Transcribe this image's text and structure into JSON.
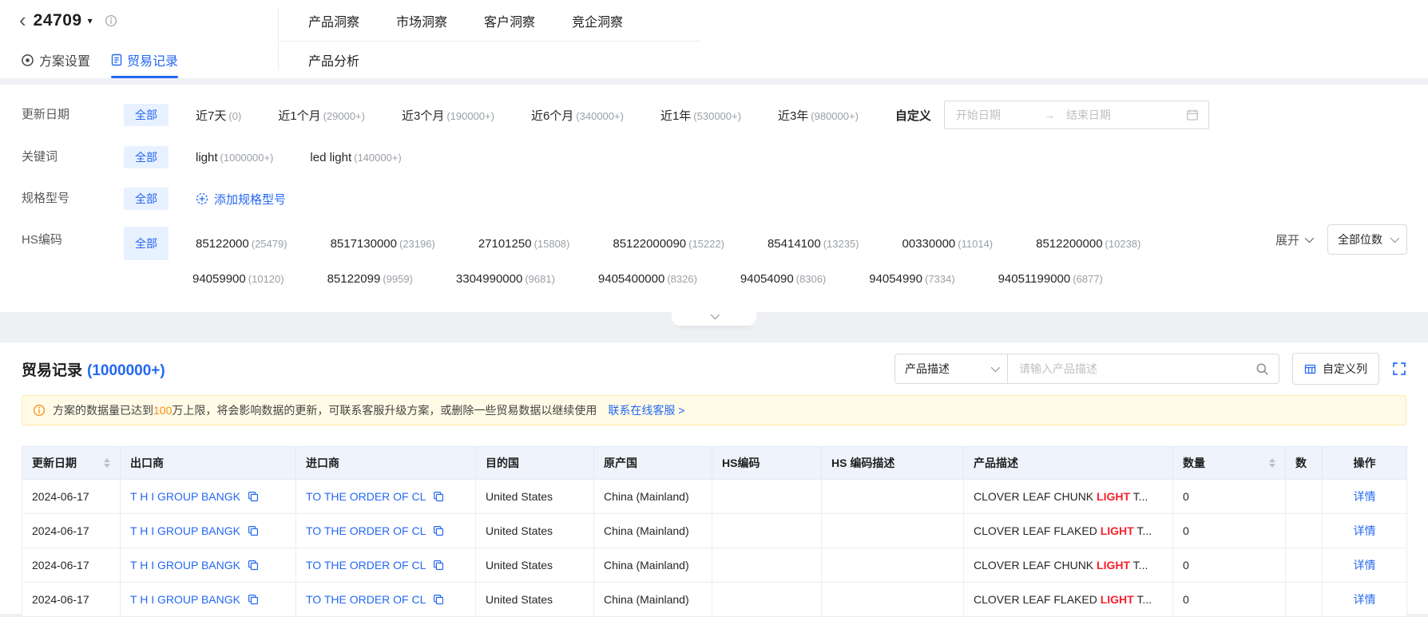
{
  "colors": {
    "accent": "#2468f2",
    "chip_bg": "#e8f1ff",
    "highlight_red": "#f5222d",
    "warn_orange": "#fa8c16",
    "warn_bg": "#fffbe6"
  },
  "icons": {
    "back": "‹",
    "caret_down": "▾"
  },
  "header": {
    "plan_id": "24709",
    "tabs": [
      "产品洞察",
      "市场洞察",
      "客户洞察",
      "竞企洞察"
    ],
    "sub_tabs": {
      "settings": "方案设置",
      "trade_records": "贸易记录",
      "product_analysis": "产品分析"
    }
  },
  "filters": {
    "update_date": {
      "label": "更新日期",
      "all_label": "全部",
      "options": [
        {
          "label": "近7天",
          "count": "(0)"
        },
        {
          "label": "近1个月",
          "count": "(29000+)"
        },
        {
          "label": "近3个月",
          "count": "(190000+)"
        },
        {
          "label": "近6个月",
          "count": "(340000+)"
        },
        {
          "label": "近1年",
          "count": "(530000+)"
        },
        {
          "label": "近3年",
          "count": "(980000+)"
        }
      ],
      "custom_label": "自定义",
      "start_placeholder": "开始日期",
      "end_placeholder": "结束日期",
      "range_arrow": "→"
    },
    "keyword": {
      "label": "关键词",
      "all_label": "全部",
      "options": [
        {
          "label": "light",
          "count": "(1000000+)"
        },
        {
          "label": "led light",
          "count": "(140000+)"
        }
      ]
    },
    "spec": {
      "label": "规格型号",
      "all_label": "全部",
      "add_label": "添加规格型号"
    },
    "hs_code": {
      "label": "HS编码",
      "all_label": "全部",
      "row1": [
        {
          "code": "85122000",
          "count": "(25479)"
        },
        {
          "code": "8517130000",
          "count": "(23196)"
        },
        {
          "code": "27101250",
          "count": "(15808)"
        },
        {
          "code": "85122000090",
          "count": "(15222)"
        },
        {
          "code": "85414100",
          "count": "(13235)"
        },
        {
          "code": "00330000",
          "count": "(11014)"
        },
        {
          "code": "8512200000",
          "count": "(10238)"
        }
      ],
      "row2": [
        {
          "code": "94059900",
          "count": "(10120)"
        },
        {
          "code": "85122099",
          "count": "(9959)"
        },
        {
          "code": "3304990000",
          "count": "(9681)"
        },
        {
          "code": "9405400000",
          "count": "(8326)"
        },
        {
          "code": "94054090",
          "count": "(8306)"
        },
        {
          "code": "94054990",
          "count": "(7334)"
        },
        {
          "code": "94051199000",
          "count": "(6877)"
        }
      ],
      "expand_label": "展开",
      "digits_label": "全部位数"
    }
  },
  "records": {
    "title": "贸易记录",
    "count": "(1000000+)",
    "search": {
      "type_label": "产品描述",
      "placeholder": "请输入产品描述"
    },
    "custom_columns_label": "自定义列",
    "banner": {
      "text_before": "方案的数据量已达到",
      "highlight": "100",
      "text_after": "万上限，将会影响数据的更新，可联系客服升级方案，或删除一些贸易数据以继续使用",
      "link_label": "联系在线客服 >"
    },
    "table": {
      "columns": [
        "更新日期",
        "出口商",
        "进口商",
        "目的国",
        "原产国",
        "HS编码",
        "HS 编码描述",
        "产品描述",
        "数量",
        "数",
        "操作"
      ],
      "rows": [
        {
          "date": "2024-06-17",
          "exporter": "T H I GROUP BANGK",
          "importer": "TO THE ORDER OF CL",
          "destination": "United States",
          "origin": "China (Mainland)",
          "hs_code": "",
          "hs_desc": "",
          "product": {
            "pre": "CLOVER LEAF CHUNK ",
            "highlight": "LIGHT",
            "post": " T..."
          },
          "quantity": "0",
          "extra": "",
          "action": "详情"
        },
        {
          "date": "2024-06-17",
          "exporter": "T H I GROUP BANGK",
          "importer": "TO THE ORDER OF CL",
          "destination": "United States",
          "origin": "China (Mainland)",
          "hs_code": "",
          "hs_desc": "",
          "product": {
            "pre": "CLOVER LEAF FLAKED ",
            "highlight": "LIGHT",
            "post": " T..."
          },
          "quantity": "0",
          "extra": "",
          "action": "详情"
        },
        {
          "date": "2024-06-17",
          "exporter": "T H I GROUP BANGK",
          "importer": "TO THE ORDER OF CL",
          "destination": "United States",
          "origin": "China (Mainland)",
          "hs_code": "",
          "hs_desc": "",
          "product": {
            "pre": "CLOVER LEAF CHUNK ",
            "highlight": "LIGHT",
            "post": " T..."
          },
          "quantity": "0",
          "extra": "",
          "action": "详情"
        },
        {
          "date": "2024-06-17",
          "exporter": "T H I GROUP BANGK",
          "importer": "TO THE ORDER OF CL",
          "destination": "United States",
          "origin": "China (Mainland)",
          "hs_code": "",
          "hs_desc": "",
          "product": {
            "pre": "CLOVER LEAF FLAKED ",
            "highlight": "LIGHT",
            "post": " T..."
          },
          "quantity": "0",
          "extra": "",
          "action": "详情"
        }
      ]
    }
  }
}
